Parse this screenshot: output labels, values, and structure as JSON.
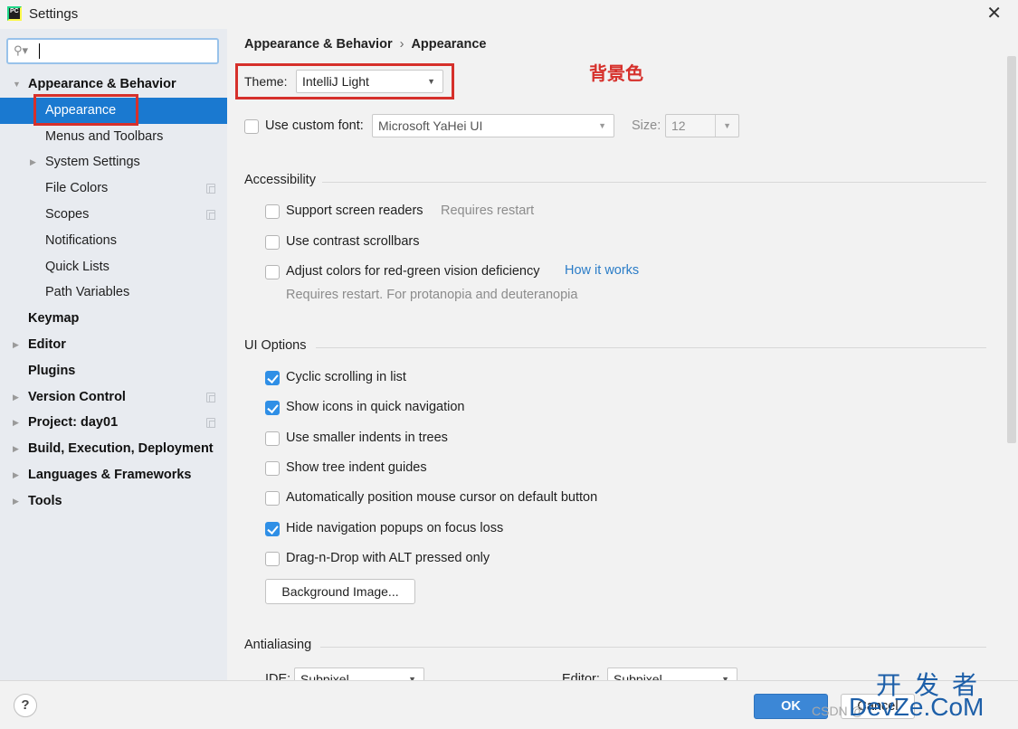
{
  "window": {
    "title": "Settings",
    "app_icon_text": "PC",
    "close_glyph": "✕"
  },
  "sidebar": {
    "search": {
      "value": "",
      "placeholder": "",
      "icon": "search-icon"
    },
    "items": [
      {
        "label": "Appearance & Behavior",
        "level": 0,
        "bold": true,
        "expander": "expanded",
        "project_icon": false
      },
      {
        "label": "Appearance",
        "level": 1,
        "bold": false,
        "expander": "none",
        "selected": true,
        "project_icon": false
      },
      {
        "label": "Menus and Toolbars",
        "level": 1,
        "bold": false,
        "expander": "none",
        "project_icon": false
      },
      {
        "label": "System Settings",
        "level": 1,
        "bold": false,
        "expander": "collapsed",
        "project_icon": false
      },
      {
        "label": "File Colors",
        "level": 1,
        "bold": false,
        "expander": "none",
        "project_icon": true
      },
      {
        "label": "Scopes",
        "level": 1,
        "bold": false,
        "expander": "none",
        "project_icon": true
      },
      {
        "label": "Notifications",
        "level": 1,
        "bold": false,
        "expander": "none",
        "project_icon": false
      },
      {
        "label": "Quick Lists",
        "level": 1,
        "bold": false,
        "expander": "none",
        "project_icon": false
      },
      {
        "label": "Path Variables",
        "level": 1,
        "bold": false,
        "expander": "none",
        "project_icon": false
      },
      {
        "label": "Keymap",
        "level": 0,
        "bold": true,
        "expander": "none",
        "project_icon": false
      },
      {
        "label": "Editor",
        "level": 0,
        "bold": true,
        "expander": "collapsed",
        "project_icon": false
      },
      {
        "label": "Plugins",
        "level": 0,
        "bold": true,
        "expander": "none",
        "project_icon": false
      },
      {
        "label": "Version Control",
        "level": 0,
        "bold": true,
        "expander": "collapsed",
        "project_icon": true
      },
      {
        "label": "Project: day01",
        "level": 0,
        "bold": true,
        "expander": "collapsed",
        "project_icon": true
      },
      {
        "label": "Build, Execution, Deployment",
        "level": 0,
        "bold": true,
        "expander": "collapsed",
        "project_icon": false
      },
      {
        "label": "Languages & Frameworks",
        "level": 0,
        "bold": true,
        "expander": "collapsed",
        "project_icon": false
      },
      {
        "label": "Tools",
        "level": 0,
        "bold": true,
        "expander": "collapsed",
        "project_icon": false
      }
    ]
  },
  "main": {
    "breadcrumb": {
      "parent": "Appearance & Behavior",
      "separator": "›",
      "current": "Appearance"
    },
    "theme": {
      "label": "Theme:",
      "value": "IntelliJ Light"
    },
    "annotation": "背景色",
    "custom_font": {
      "label": "Use custom font:",
      "checked": false,
      "value": "Microsoft YaHei UI",
      "size_label": "Size:",
      "size_value": "12"
    },
    "accessibility": {
      "title": "Accessibility",
      "screen_readers": {
        "label": "Support screen readers",
        "checked": false,
        "hint": "Requires restart"
      },
      "contrast_scrollbars": {
        "label": "Use contrast scrollbars",
        "checked": false
      },
      "red_green": {
        "label": "Adjust colors for red-green vision deficiency",
        "checked": false,
        "link": "How it works",
        "hint": "Requires restart. For protanopia and deuteranopia"
      }
    },
    "ui_options": {
      "title": "UI Options",
      "options": [
        {
          "label": "Cyclic scrolling in list",
          "checked": true
        },
        {
          "label": "Show icons in quick navigation",
          "checked": true
        },
        {
          "label": "Use smaller indents in trees",
          "checked": false
        },
        {
          "label": "Show tree indent guides",
          "checked": false
        },
        {
          "label": "Automatically position mouse cursor on default button",
          "checked": false
        },
        {
          "label": "Hide navigation popups on focus loss",
          "checked": true
        },
        {
          "label": "Drag-n-Drop with ALT pressed only",
          "checked": false
        }
      ],
      "background_image_button": "Background Image..."
    },
    "antialiasing": {
      "title": "Antialiasing",
      "ide_label": "IDE:",
      "ide_value": "Subpixel",
      "editor_label": "Editor:",
      "editor_value": "Subpixel"
    }
  },
  "footer": {
    "help": "?",
    "ok": "OK",
    "cancel": "Cancel"
  },
  "watermark": {
    "line1": "开发者",
    "line2": "DevZe.CoM",
    "csdn": "CSDN @"
  },
  "colors": {
    "selection": "#1a79d0",
    "checkbox_on": "#2f8fe6",
    "ok_button": "#3c87d6",
    "link": "#2a7cc7",
    "annotation_red": "#d6302b",
    "sidebar_bg": "#e8ebf0",
    "panel_bg": "#f2f2f2"
  }
}
